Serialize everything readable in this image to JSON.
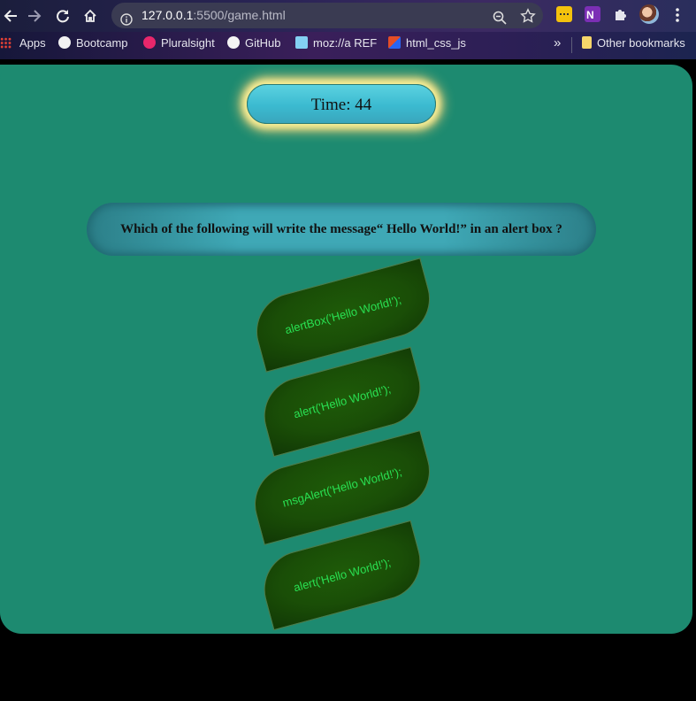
{
  "browser": {
    "url_host": "127.0.0.1",
    "url_rest": ":5500/game.html",
    "bookmarks": {
      "apps": "Apps",
      "bootcamp": "Bootcamp",
      "pluralsight": "Pluralsight",
      "github": "GitHub",
      "mdn": "moz://a REF",
      "html_css_js": "html_css_js",
      "overflow": "»",
      "other": "Other bookmarks"
    },
    "icons": [
      "back-arrow-icon",
      "forward-arrow-icon",
      "reload-icon",
      "home-icon",
      "site-info-icon",
      "zoom-icon",
      "star-icon",
      "extension-icon",
      "onenote-icon",
      "puzzle-icon",
      "profile-avatar",
      "kebab-menu-icon"
    ]
  },
  "game": {
    "timer_label": "Time: 44",
    "question": "Which of the following will write the message“ Hello World!” in an alert box ?",
    "answers": [
      "alertBox('Hello World!');",
      "alert('Hello World!');",
      "msgAlert('Hello World!');",
      "alert('Hello World!');"
    ]
  },
  "colors": {
    "page_bg": "#1d8a70",
    "timer_bg": "#3bbad0",
    "timer_glow": "#f7f29a",
    "answer_bg": "#1a4e07",
    "answer_text": "#29e052"
  }
}
